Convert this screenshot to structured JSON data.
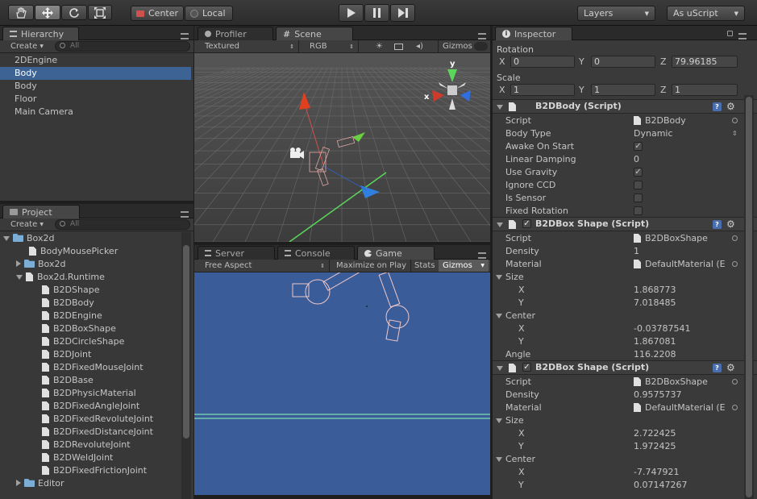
{
  "toolbar": {
    "pivot_label": "Center",
    "space_label": "Local",
    "layers_label": "Layers",
    "layout_label": "As uScript"
  },
  "hierarchy": {
    "tab": "Hierarchy",
    "create_label": "Create",
    "search_placeholder": "All",
    "items": [
      "2DEngine",
      "Body",
      "Body",
      "Floor",
      "Main Camera"
    ]
  },
  "project": {
    "tab": "Project",
    "create_label": "Create",
    "search_placeholder": "All",
    "items": [
      {
        "label": "Box2d",
        "type": "folder"
      },
      {
        "label": "BodyMousePicker",
        "type": "file"
      },
      {
        "label": "Box2d",
        "type": "folder"
      },
      {
        "label": "Box2d.Runtime",
        "type": "file"
      },
      {
        "label": "B2DShape",
        "type": "file"
      },
      {
        "label": "B2DBody",
        "type": "file"
      },
      {
        "label": "B2DEngine",
        "type": "file"
      },
      {
        "label": "B2DBoxShape",
        "type": "file"
      },
      {
        "label": "B2DCircleShape",
        "type": "file"
      },
      {
        "label": "B2DJoint",
        "type": "file"
      },
      {
        "label": "B2DFixedMouseJoint",
        "type": "file"
      },
      {
        "label": "B2DBase",
        "type": "file"
      },
      {
        "label": "B2DPhysicMaterial",
        "type": "file"
      },
      {
        "label": "B2DFixedAngleJoint",
        "type": "file"
      },
      {
        "label": "B2DFixedRevoluteJoint",
        "type": "file"
      },
      {
        "label": "B2DFixedDistanceJoint",
        "type": "file"
      },
      {
        "label": "B2DRevoluteJoint",
        "type": "file"
      },
      {
        "label": "B2DWeldJoint",
        "type": "file"
      },
      {
        "label": "B2DFixedFrictionJoint",
        "type": "file"
      },
      {
        "label": "Editor",
        "type": "folder"
      }
    ]
  },
  "scene_tabs": {
    "profiler": "Profiler",
    "scene": "Scene"
  },
  "scene_bar": {
    "shading": "Textured",
    "render_mode": "RGB",
    "gizmos": "Gizmos"
  },
  "gizmo_axes": {
    "x": "x",
    "y": "y"
  },
  "game_tabs": {
    "server": "Server",
    "console": "Console",
    "game": "Game"
  },
  "game_bar": {
    "aspect": "Free Aspect",
    "maximize": "Maximize on Play",
    "stats": "Stats",
    "gizmos": "Gizmos"
  },
  "inspector": {
    "tab": "Inspector",
    "rotation": {
      "label": "Rotation",
      "x": "0",
      "y": "0",
      "z": "79.96185"
    },
    "scale": {
      "label": "Scale",
      "x": "1",
      "y": "1",
      "z": "1"
    },
    "axis": {
      "x": "X",
      "y": "Y",
      "z": "Z"
    },
    "body": {
      "title": "B2DBody (Script)",
      "rows": [
        {
          "label": "Script",
          "value": "B2DBody"
        },
        {
          "label": "Body Type",
          "value": "Dynamic"
        },
        {
          "label": "Awake On Start",
          "value": "✓"
        },
        {
          "label": "Linear Damping",
          "value": "0"
        },
        {
          "label": "Use Gravity",
          "value": "✓"
        },
        {
          "label": "Ignore CCD",
          "value": ""
        },
        {
          "label": "Is Sensor",
          "value": ""
        },
        {
          "label": "Fixed Rotation",
          "value": ""
        }
      ]
    },
    "box1": {
      "title": "B2DBox Shape (Script)",
      "script_label": "Script",
      "script": "B2DBoxShape",
      "density_label": "Density",
      "density": "1",
      "material_label": "Material",
      "material": "DefaultMaterial (E",
      "size_label": "Size",
      "size_x": "1.868773",
      "size_y": "7.018485",
      "center_label": "Center",
      "center_x": "-0.03787541",
      "center_y": "1.867081",
      "angle_label": "Angle",
      "angle": "116.2208"
    },
    "box2": {
      "title": "B2DBox Shape (Script)",
      "script_label": "Script",
      "script": "B2DBoxShape",
      "density_label": "Density",
      "density": "0.9575737",
      "material_label": "Material",
      "material": "DefaultMaterial (E",
      "size_label": "Size",
      "size_x": "2.722425",
      "size_y": "1.972425",
      "center_label": "Center",
      "center_x": "-7.747921",
      "center_y": "0.07147267"
    }
  },
  "colors": {
    "selection": "#3d6395",
    "game_bg": "#3a5c99",
    "floor_line": "#7fe0b0"
  }
}
